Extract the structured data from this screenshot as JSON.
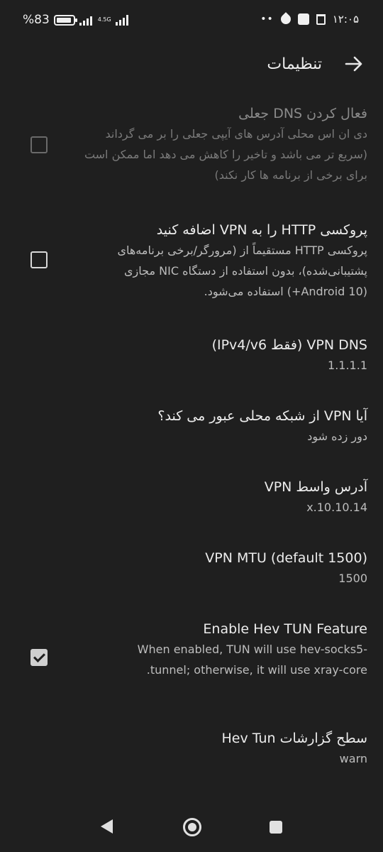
{
  "status_bar": {
    "battery_label": "%83",
    "network_type": "4.5G",
    "time": "۱۲:۰۵",
    "dots": "••"
  },
  "app_bar": {
    "title": "تنظیمات"
  },
  "settings": [
    {
      "title": "فعال کردن DNS جعلی",
      "summary": "دی ان اس محلی آدرس های آیپی جعلی را بر می گرداند (سریع تر می باشد و تاخیر را کاهش می دهد اما ممکن است برای برخی از برنامه ها کار نکند)",
      "checked": false,
      "enabled": false
    },
    {
      "title": "پروکسی HTTP را به VPN اضافه کنید",
      "summary": "پروکسی HTTP مستقیماً از (مرورگر/برخی برنامه‌های پشتیبانی‌شده)، بدون استفاده از دستگاه NIC مجازی (Android 10+) استفاده می‌شود.",
      "checked": false,
      "enabled": true
    },
    {
      "title": "VPN DNS (فقط IPv4/v6)",
      "summary": "1.1.1.1"
    },
    {
      "title": "آیا VPN از شبکه محلی عبور می کند؟",
      "summary": "دور زده شود"
    },
    {
      "title": "آدرس واسط VPN",
      "summary": "10.10.14.x"
    },
    {
      "title": "VPN MTU (default 1500)",
      "summary": "1500"
    },
    {
      "title": "Enable Hev TUN Feature",
      "summary": "When enabled, TUN will use hev-socks5-tunnel; otherwise, it will use xray-core.",
      "checked": true,
      "enabled": true
    },
    {
      "title": "سطح گزارشات Hev Tun",
      "summary": "warn"
    }
  ],
  "colors": {
    "background": "#1f1f1f",
    "text_primary": "#ececec",
    "text_secondary": "#bdbdbd",
    "text_disabled": "#8a8a8a"
  }
}
